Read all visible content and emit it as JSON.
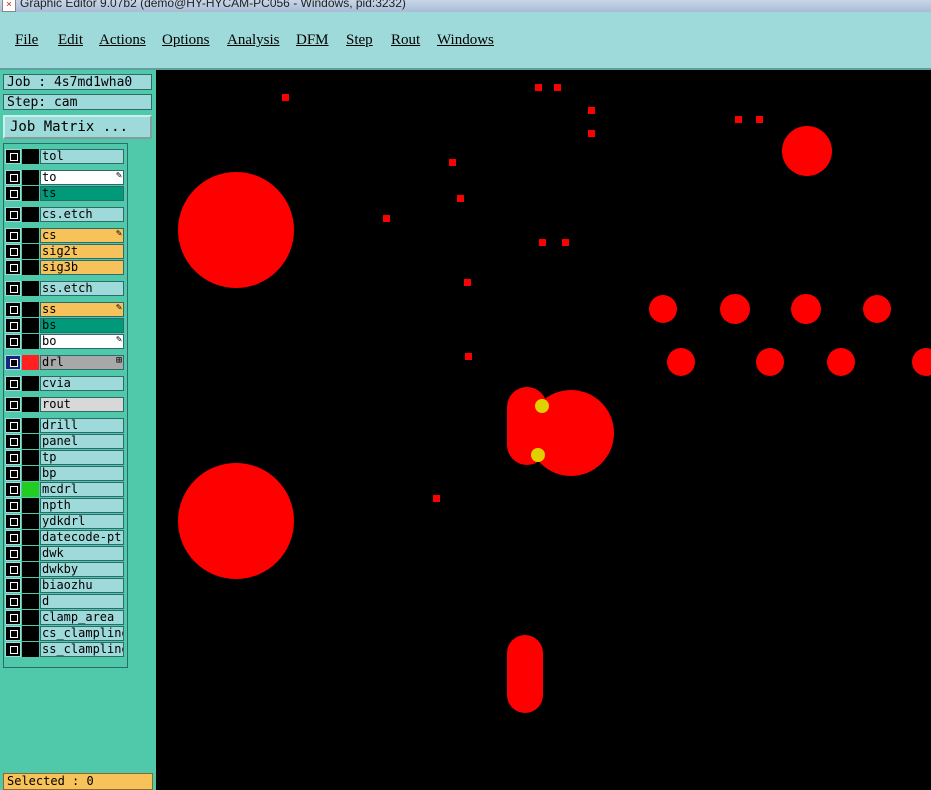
{
  "window": {
    "title": "Graphic Editor 9.07b2 (demo@HY-HYCAM-PC056 - Windows, pid:3232)"
  },
  "menu": [
    "File",
    "Edit",
    "Actions",
    "Options",
    "Analysis",
    "DFM",
    "Step",
    "Rout",
    "Windows"
  ],
  "job": {
    "label": "Job : 4s7md1wha0",
    "step": "Step: cam"
  },
  "job_matrix_label": "Job Matrix ...",
  "colors": {
    "panel": "#4fc9a9",
    "menu": "#9fdada",
    "pad": "#ff0000",
    "highlight": "#e0d000"
  },
  "layers": [
    {
      "name": "tol",
      "color": "#9fdada",
      "marker": "#000000",
      "flag": ""
    },
    {
      "name": "to",
      "color": "#ffffff",
      "marker": "#000000",
      "flag": "edit"
    },
    {
      "name": "ts",
      "color": "#00997a",
      "marker": "#000000",
      "flag": ""
    },
    {
      "name": "cs.etch",
      "color": "#9fdada",
      "marker": "#000000",
      "flag": ""
    },
    {
      "name": "cs",
      "color": "#f7c25a",
      "marker": "#000000",
      "flag": "edit"
    },
    {
      "name": "sig2t",
      "color": "#f7c25a",
      "marker": "#000000",
      "flag": ""
    },
    {
      "name": "sig3b",
      "color": "#f7c25a",
      "marker": "#000000",
      "flag": ""
    },
    {
      "name": "ss.etch",
      "color": "#9fdada",
      "marker": "#000000",
      "flag": ""
    },
    {
      "name": "ss",
      "color": "#f7c25a",
      "marker": "#000000",
      "flag": "edit"
    },
    {
      "name": "bs",
      "color": "#00997a",
      "marker": "#000000",
      "flag": ""
    },
    {
      "name": "bo",
      "color": "#ffffff",
      "marker": "#000000",
      "flag": "edit"
    },
    {
      "name": "drl",
      "color": "#a8a8a8",
      "marker": "#ff2020",
      "flag": "drill",
      "active": true
    },
    {
      "name": "cvia",
      "color": "#9fdada",
      "marker": "#000000",
      "flag": ""
    },
    {
      "name": "rout",
      "color": "#d8d8d8",
      "marker": "#000000",
      "flag": ""
    },
    {
      "name": "drill",
      "color": "#9fdada",
      "marker": "#000000",
      "flag": ""
    },
    {
      "name": "panel",
      "color": "#9fdada",
      "marker": "#000000",
      "flag": ""
    },
    {
      "name": "tp",
      "color": "#9fdada",
      "marker": "#000000",
      "flag": ""
    },
    {
      "name": "bp",
      "color": "#9fdada",
      "marker": "#000000",
      "flag": ""
    },
    {
      "name": "mcdrl",
      "color": "#9fdada",
      "marker": "#22cc22",
      "flag": ""
    },
    {
      "name": "npth",
      "color": "#9fdada",
      "marker": "#000000",
      "flag": ""
    },
    {
      "name": "ydkdrl",
      "color": "#9fdada",
      "marker": "#000000",
      "flag": ""
    },
    {
      "name": "datecode-pt",
      "color": "#9fdada",
      "marker": "#000000",
      "flag": ""
    },
    {
      "name": "dwk",
      "color": "#9fdada",
      "marker": "#000000",
      "flag": ""
    },
    {
      "name": "dwkby",
      "color": "#9fdada",
      "marker": "#000000",
      "flag": ""
    },
    {
      "name": "biaozhu",
      "color": "#9fdada",
      "marker": "#000000",
      "flag": ""
    },
    {
      "name": "d",
      "color": "#9fdada",
      "marker": "#000000",
      "flag": ""
    },
    {
      "name": "clamp_area",
      "color": "#9fdada",
      "marker": "#000000",
      "flag": ""
    },
    {
      "name": "cs_clampline",
      "color": "#9fdada",
      "marker": "#000000",
      "flag": ""
    },
    {
      "name": "ss_clampline",
      "color": "#9fdada",
      "marker": "#000000",
      "flag": ""
    }
  ],
  "status": {
    "selected": "Selected : 0"
  }
}
